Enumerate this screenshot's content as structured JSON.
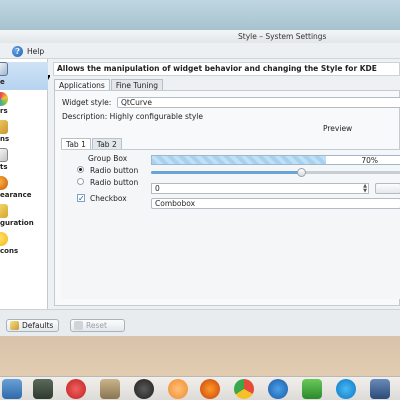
{
  "window": {
    "title": "Style – System Settings"
  },
  "menubar": {
    "help_label": "Help"
  },
  "sidebar": {
    "items": [
      {
        "label": "e",
        "icon": "style-icon",
        "active": true
      },
      {
        "label": "rs",
        "icon": "colors-icon"
      },
      {
        "label": "ns",
        "icon": "icons-icon"
      },
      {
        "label": "ts",
        "icon": "fonts-icon"
      },
      {
        "label": "earance",
        "icon": "appearance-icon"
      },
      {
        "label": "guration",
        "icon": "configuration-icon"
      },
      {
        "label": "cons",
        "icon": "emoticons-icon"
      }
    ]
  },
  "content": {
    "heading": "Allows the manipulation of widget behavior and changing the Style for KDE",
    "tabs": [
      "Applications",
      "Fine Tuning"
    ],
    "widget_style_label": "Widget style:",
    "widget_style_value": "QtCurve",
    "description_label": "Description: Highly configurable style",
    "preview_label": "Preview",
    "preview_tabs": [
      "Tab 1",
      "Tab 2"
    ],
    "group_box_label": "Group Box",
    "radio1_label": "Radio button",
    "radio2_label": "Radio button",
    "checkbox_label": "Checkbox",
    "progress_text": "70%",
    "progress_value": 0.7,
    "slider_value": 0.6,
    "spin_value": "0",
    "combobox_label": "Combobox"
  },
  "buttons": {
    "defaults_label": "Defaults",
    "reset_label": "Reset"
  },
  "colors": {
    "accent": "#6aa3d6",
    "progress": "#a9d1ee"
  }
}
